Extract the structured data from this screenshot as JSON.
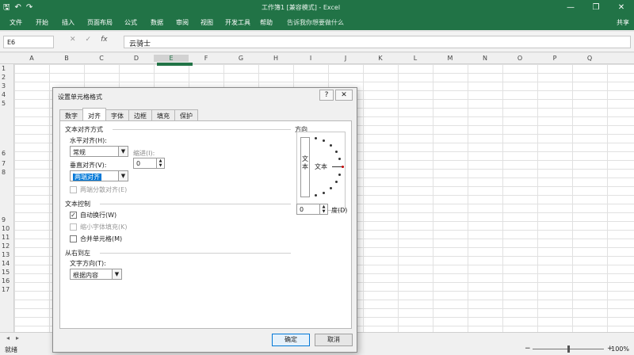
{
  "window": {
    "title": "工作簿1 [兼容模式] - Excel",
    "quick_access": {
      "save": "🖫",
      "undo": "↶",
      "redo": "↷"
    },
    "controls": {
      "minimize": "—",
      "restore": "❐",
      "close": "✕"
    }
  },
  "ribbon": {
    "tabs": [
      "文件",
      "开始",
      "插入",
      "页面布局",
      "公式",
      "数据",
      "审阅",
      "视图",
      "开发工具",
      "帮助"
    ],
    "tell_me": "告诉我你想要做什么",
    "share": "共享"
  },
  "formula_bar": {
    "name_box": "E6",
    "cancel": "✕",
    "enter": "✓",
    "fx": "fx",
    "value": "云骑士"
  },
  "grid": {
    "columns": [
      "A",
      "B",
      "C",
      "D",
      "E",
      "F",
      "G",
      "H",
      "I",
      "J",
      "K",
      "L",
      "M",
      "N",
      "O",
      "P",
      "Q"
    ],
    "rows": [
      "1",
      "2",
      "3",
      "4",
      "5",
      "6",
      "7",
      "8",
      "9",
      "10",
      "11",
      "12",
      "13",
      "14",
      "15",
      "16",
      "17"
    ]
  },
  "status": {
    "ready": "就绪",
    "zoom": "100%",
    "zoom_minus": "−",
    "zoom_plus": "+"
  },
  "dialog": {
    "title": "设置单元格格式",
    "help": "?",
    "close": "✕",
    "tabs": [
      "数字",
      "对齐",
      "字体",
      "边框",
      "填充",
      "保护"
    ],
    "active_tab": "对齐",
    "text_alignment": {
      "section": "文本对齐方式",
      "horizontal_label": "水平对齐(H):",
      "horizontal_value": "常规",
      "indent_label": "缩进(I):",
      "indent_value": "0",
      "vertical_label": "垂直对齐(V):",
      "vertical_value": "两端对齐",
      "distributed": "两端分散对齐(E)"
    },
    "text_control": {
      "section": "文本控制",
      "wrap": "自动换行(W)",
      "wrap_checked": "✓",
      "shrink": "缩小字体填充(K)",
      "merge": "合并单元格(M)"
    },
    "rtl": {
      "section": "从右到左",
      "direction_label": "文字方向(T):",
      "direction_value": "根据内容"
    },
    "orientation": {
      "section": "方向",
      "vertical_text": "文本",
      "horizontal_text": "文本",
      "degrees_value": "0",
      "degrees_label": "度(D)"
    },
    "buttons": {
      "ok": "确定",
      "cancel": "取消"
    }
  }
}
